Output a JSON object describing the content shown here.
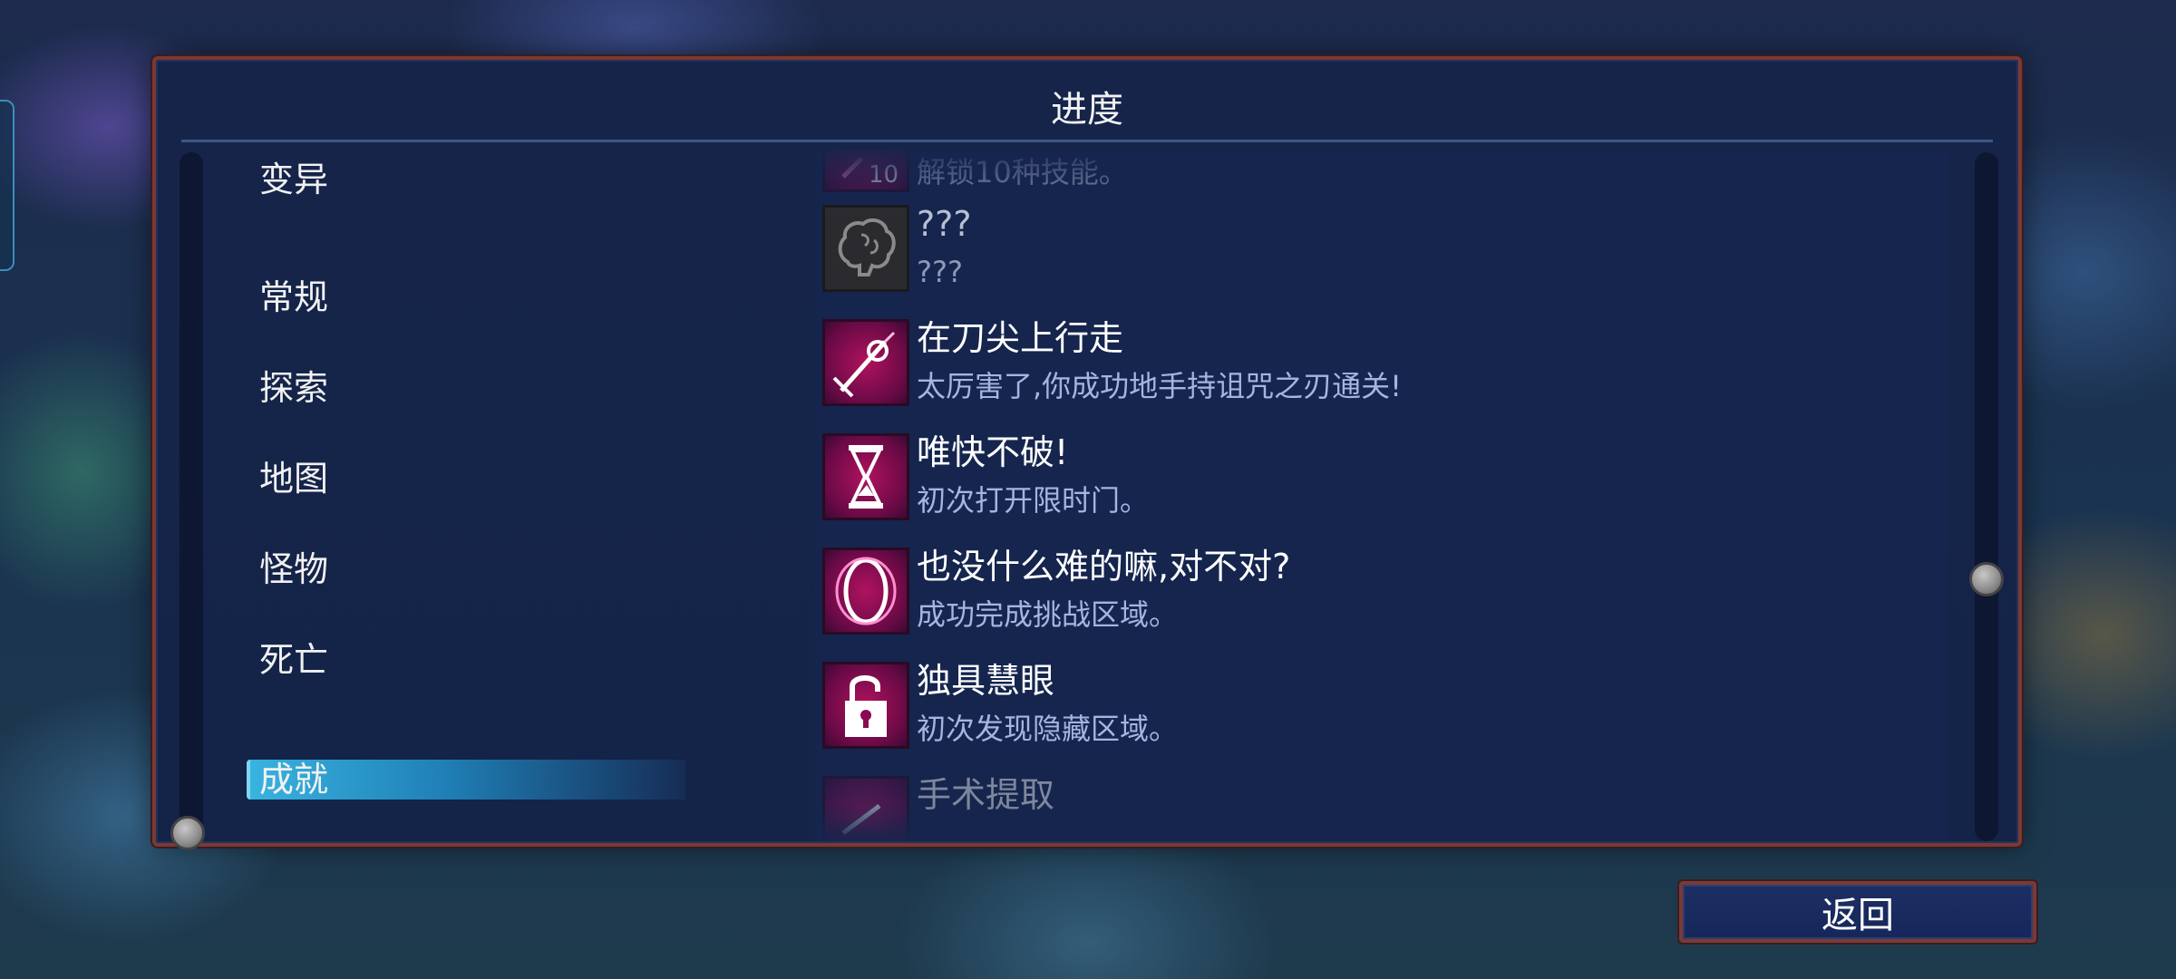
{
  "panel": {
    "title": "进度"
  },
  "categories": [
    {
      "label": "变异",
      "active": false
    },
    {
      "label": "常规",
      "active": false
    },
    {
      "label": "探索",
      "active": false
    },
    {
      "label": "地图",
      "active": false
    },
    {
      "label": "怪物",
      "active": false
    },
    {
      "label": "死亡",
      "active": false
    },
    {
      "label": "成就",
      "active": true
    }
  ],
  "achievements": [
    {
      "name": "",
      "desc": "解锁10种技能。",
      "badge": "10",
      "icon": "skill-unlock-icon",
      "state": "partial-top"
    },
    {
      "name": "???",
      "desc": "???",
      "icon": "brain-icon",
      "state": "locked"
    },
    {
      "name": "在刀尖上行走",
      "desc": "太厉害了,你成功地手持诅咒之刃通关!",
      "icon": "cursed-sword-icon",
      "state": "unlocked"
    },
    {
      "name": "唯快不破!",
      "desc": "初次打开限时门。",
      "icon": "hourglass-icon",
      "state": "unlocked"
    },
    {
      "name": "也没什么难的嘛,对不对?",
      "desc": "成功完成挑战区域。",
      "icon": "challenge-ring-icon",
      "state": "unlocked"
    },
    {
      "name": "独具慧眼",
      "desc": "初次发现隐藏区域。",
      "icon": "unlock-padlock-icon",
      "state": "unlocked"
    },
    {
      "name": "手术提取",
      "desc": "",
      "icon": "surgery-icon",
      "state": "partial-bottom"
    }
  ],
  "footer": {
    "back_label": "返回"
  },
  "colors": {
    "panel_border": "#7a3a33",
    "panel_bg": "#16244a",
    "active_tab": "#38b3e0",
    "icon_magenta": "#b0125e",
    "desc_text": "#a6b4e0"
  }
}
